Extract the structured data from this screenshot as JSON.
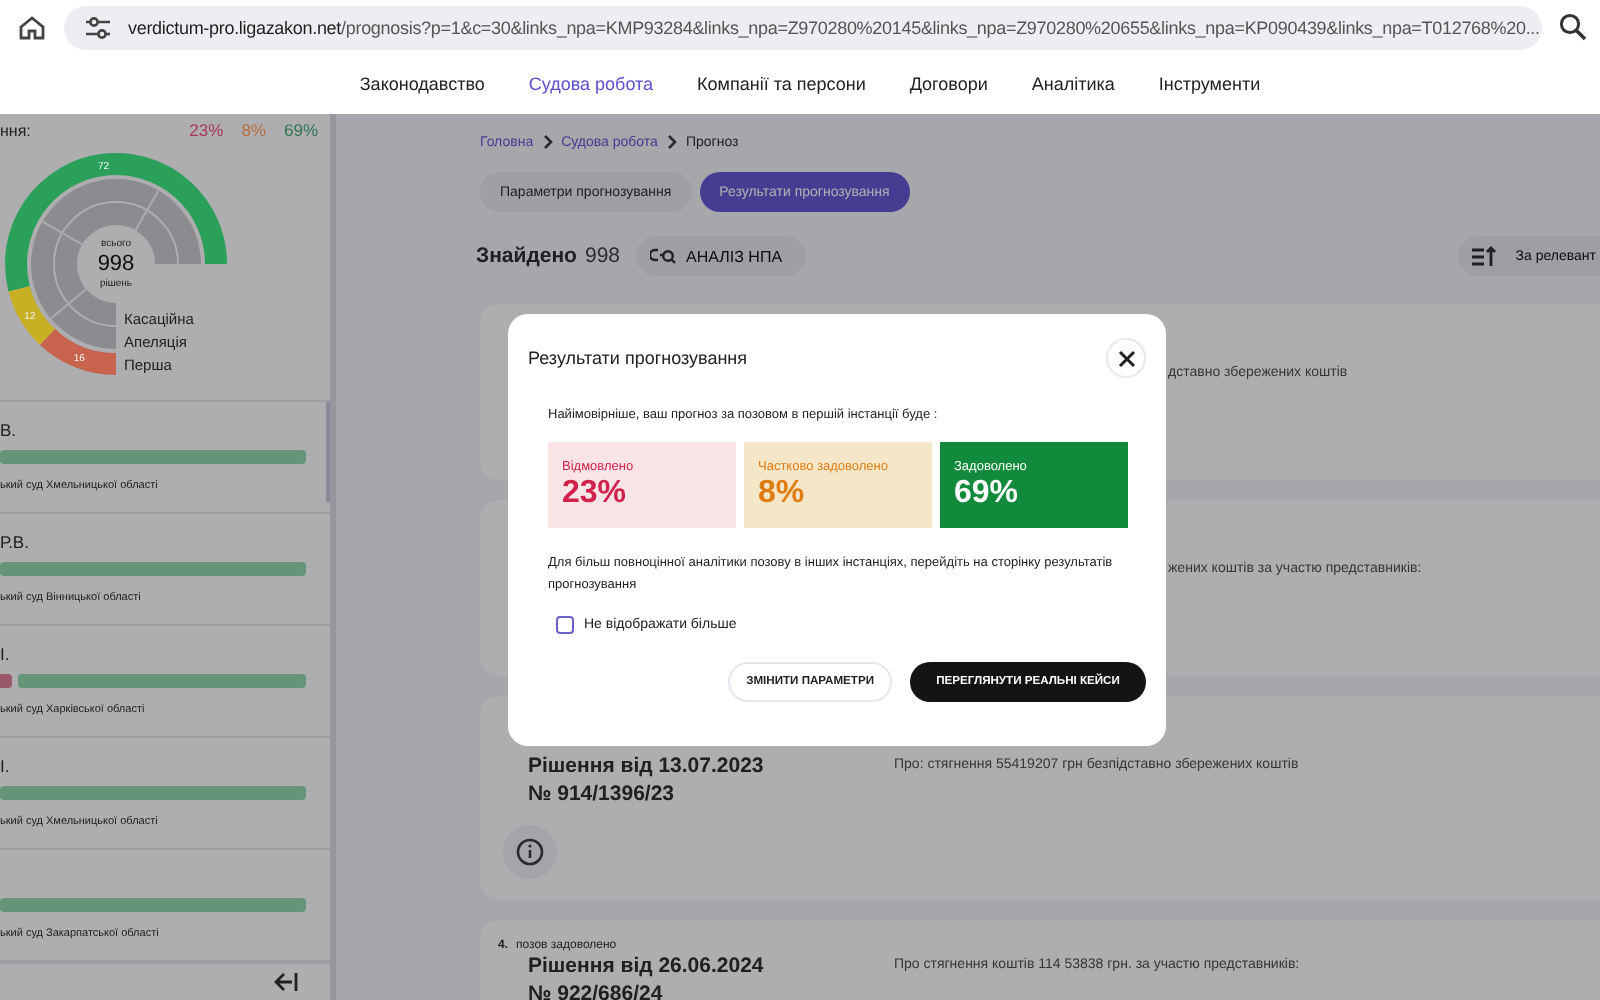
{
  "browser": {
    "url_host": "verdictum-pro.ligazakon.net",
    "url_path": "/prognosis?p=1&c=30&links_npa=KMP93284&links_npa=Z970280%20145&links_npa=Z970280%20655&links_npa=KP090439&links_npa=T012768%20..."
  },
  "nav": [
    {
      "label": "Законодавство",
      "selected": false
    },
    {
      "label": "Судова робота",
      "selected": true
    },
    {
      "label": "Компанії та персони",
      "selected": false
    },
    {
      "label": "Договори",
      "selected": false
    },
    {
      "label": "Аналітика",
      "selected": false
    },
    {
      "label": "Інструменти",
      "selected": false
    }
  ],
  "sidebar": {
    "heading": "ння:",
    "percents": [
      {
        "text": "23%",
        "color": "#a8345a"
      },
      {
        "text": "8%",
        "color": "#b87040"
      },
      {
        "text": "69%",
        "color": "#2f7450"
      }
    ],
    "donut": {
      "total_caption": "всього",
      "total": "998",
      "total_unit": "рішень",
      "segments": [
        {
          "value": "72",
          "color": "#2aa05a"
        },
        {
          "value": "12",
          "color": "#c8b024"
        },
        {
          "value": "16",
          "color": "#c8644e"
        }
      ],
      "legend": [
        "Касаційна",
        "Апеляція",
        "Перша"
      ]
    },
    "judges": [
      {
        "name": "В.",
        "level": 1,
        "court": "ький суд Хмельницької області"
      },
      {
        "name": "Р.В.",
        "level": 1,
        "court": "ький суд Вінницької області"
      },
      {
        "name": "І.",
        "level": 0.94,
        "court": "ький суд Харківської області"
      },
      {
        "name": "І.",
        "level": 1,
        "court": "ький суд Хмельницької області"
      },
      {
        "level": 1,
        "court": "ький суд Закарпатської області"
      }
    ]
  },
  "breadcrumbs": [
    {
      "label": "Головна",
      "current": false
    },
    {
      "label": "Судова робота",
      "current": false
    },
    {
      "label": "Прогноз",
      "current": true
    }
  ],
  "tabs": [
    {
      "label": "Параметри прогнозування",
      "selected": false
    },
    {
      "label": "Результати прогнозування",
      "selected": true
    }
  ],
  "found": {
    "label": "Знайдено",
    "count": "998"
  },
  "analysis_button": "АНАЛІЗ НПА",
  "sort_button": "За релевант",
  "cards": [
    {
      "description": "дставно збережених коштів",
      "covered": true
    },
    {
      "description": "жених коштів за участю представників:",
      "covered": true
    },
    {
      "title": [
        "Рішення від 13.07.2023",
        "№ 914/1396/23"
      ],
      "description": "Про: стягнення 55419207 грн безпідставно збережених коштів",
      "info": true,
      "covered": false
    },
    {
      "number": "4.",
      "status": "позов задоволено",
      "title": [
        "Рішення від 26.06.2024",
        "№ 922/686/24"
      ],
      "description": "Про стягнення коштів 114 53838 грн. за участю представників:",
      "covered": false
    }
  ],
  "modal": {
    "title": "Результати прогнозування",
    "intro": "Найімовірніше, ваш прогноз за позовом в першій інстанції буде :",
    "outcomes": [
      {
        "kind": "refused",
        "label": "Відмовлено",
        "value": "23%"
      },
      {
        "kind": "partial",
        "label": "Частково задоволено",
        "value": "8%"
      },
      {
        "kind": "satisfied",
        "label": "Задоволено",
        "value": "69%"
      }
    ],
    "note": "Для більш повноцінної аналітики позову в інших інстанціях, перейдіть на сторінку результатів прогнозування",
    "checkbox": {
      "label": "Не відображати більше",
      "checked": false
    },
    "buttons": [
      {
        "kind": "secondary",
        "label": "ЗМІНИТИ ПАРАМЕТРИ"
      },
      {
        "kind": "primary",
        "label": "ПЕРЕГЛЯНУТИ РЕАЛЬНІ КЕЙСИ"
      }
    ]
  }
}
